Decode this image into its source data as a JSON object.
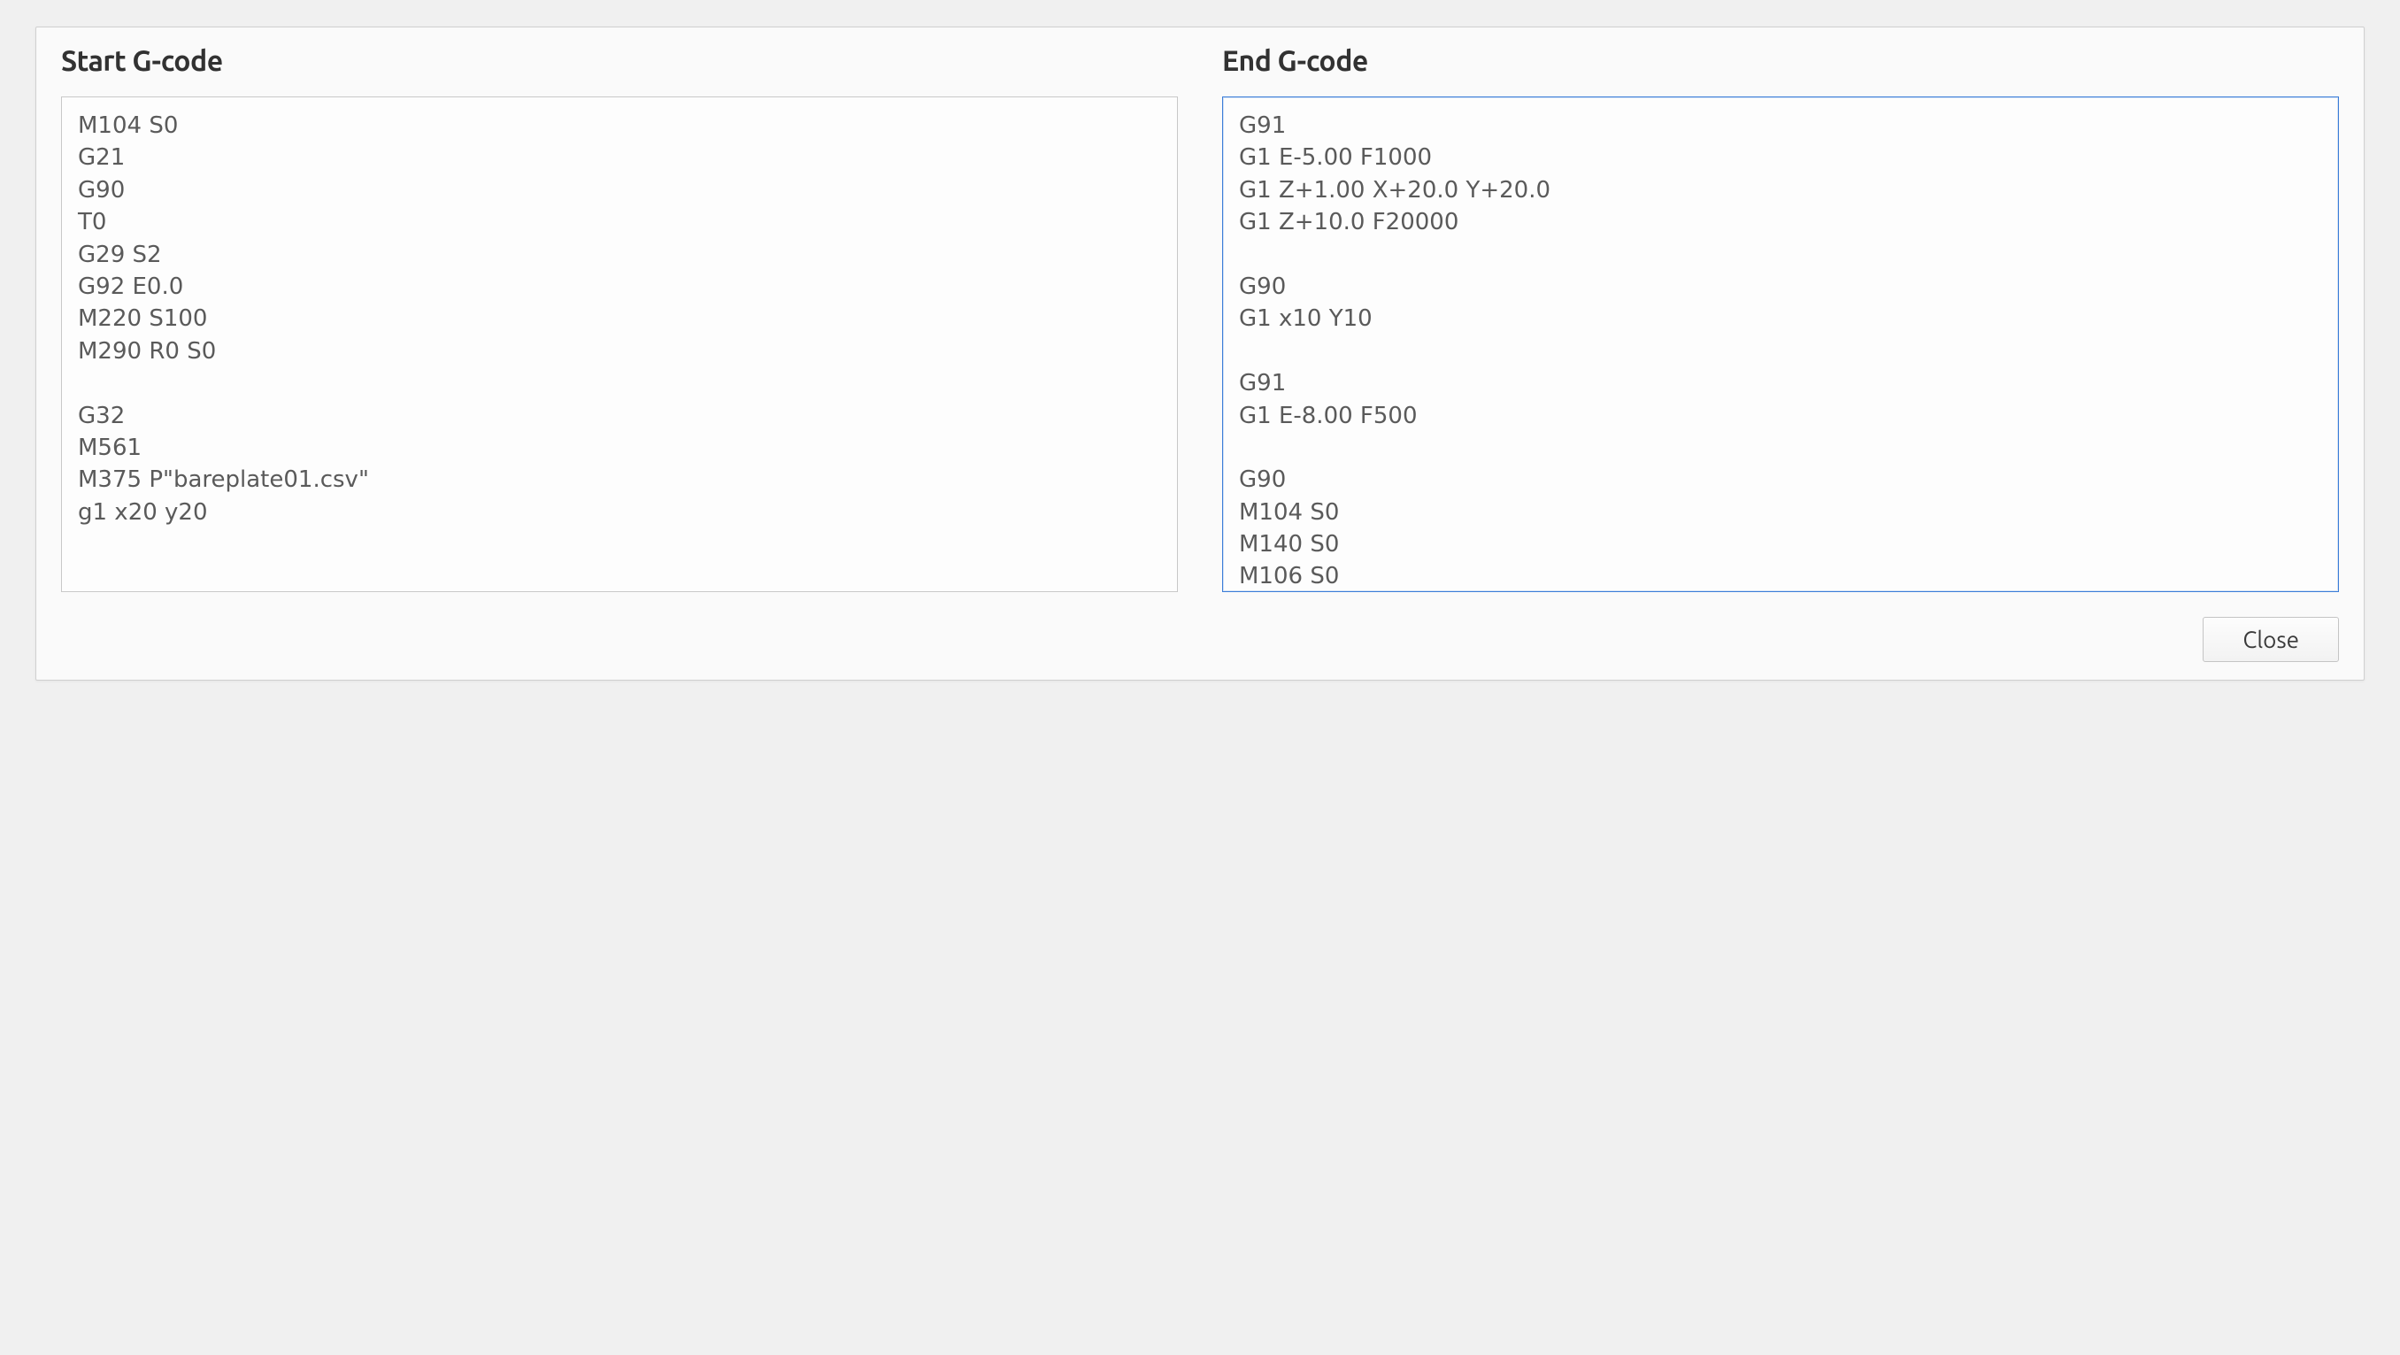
{
  "dialog": {
    "start_section": {
      "heading": "Start G-code",
      "content": "M104 S0\nG21\nG90\nT0\nG29 S2\nG92 E0.0\nM220 S100\nM290 R0 S0\n\nG32\nM561\nM375 P\"bareplate01.csv\"\ng1 x20 y20"
    },
    "end_section": {
      "heading": "End G-code",
      "content": "G91\nG1 E-5.00 F1000\nG1 Z+1.00 X+20.0 Y+20.0\nG1 Z+10.0 F20000\n\nG90\nG1 x10 Y10\n\nG91\nG1 E-8.00 F500\n\nG90\nM104 S0\nM140 S0\nM106 S0"
    },
    "close_button_label": "Close"
  }
}
